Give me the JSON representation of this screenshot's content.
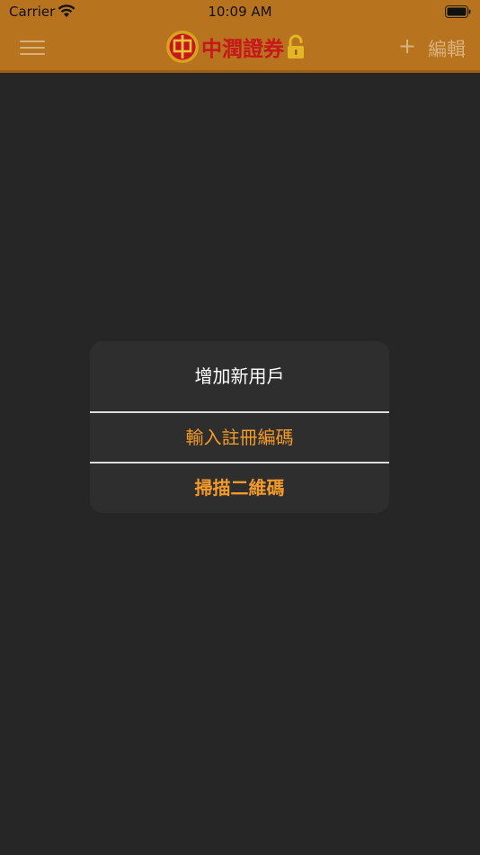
{
  "status_bar": {
    "carrier": "Carrier",
    "time": "10:09 AM",
    "wifi_icon": "wifi-icon",
    "battery_icon": "battery-icon"
  },
  "nav": {
    "menu_icon": "hamburger-menu-icon",
    "brand_name": "中潤證券",
    "logo_icon": "zhongrun-logo-icon",
    "lock_icon": "lock-icon",
    "add_label": "+",
    "edit_label": "編輯"
  },
  "dialog": {
    "title": "增加新用戶",
    "options": [
      {
        "label": "輸入註冊編碼"
      },
      {
        "label": "掃描二維碼"
      }
    ]
  },
  "colors": {
    "header": "#b8731f",
    "background": "#262626",
    "dialog_bg": "#2e2e2e",
    "accent": "#f39a2a",
    "brand_red": "#c8171c"
  }
}
